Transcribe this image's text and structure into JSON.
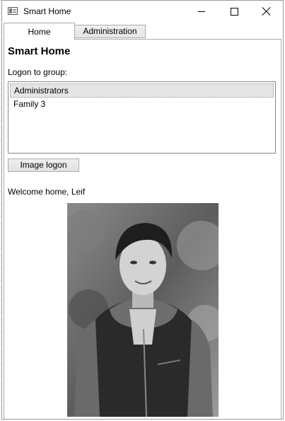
{
  "window": {
    "title": "Smart Home",
    "icon": "app-window-icon",
    "controls": [
      "minimize-icon",
      "maximize-icon",
      "close-icon"
    ]
  },
  "tabs": [
    {
      "label": "Home",
      "selected": true
    },
    {
      "label": "Administration",
      "selected": false
    }
  ],
  "main": {
    "heading": "Smart Home",
    "group_label": "Logon to group:",
    "groups": [
      {
        "label": "Administrators",
        "selected": true
      },
      {
        "label": "Family 3",
        "selected": false
      }
    ],
    "image_logon_label": "Image logon",
    "welcome_text": "Welcome home, Leif"
  },
  "colors": {
    "tab_border": "#acacac",
    "selected_item_bg": "#e5e5e5",
    "button_bg": "#e1e1e1"
  }
}
